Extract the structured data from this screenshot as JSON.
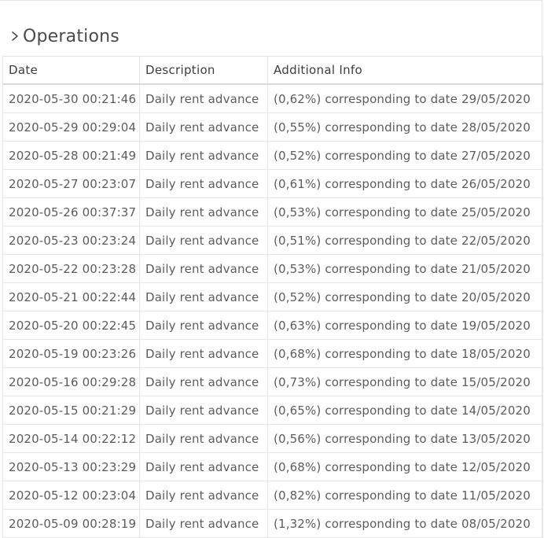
{
  "section": {
    "title": "Operations"
  },
  "table": {
    "headers": {
      "date": "Date",
      "description": "Description",
      "info": "Additional Info"
    },
    "rows": [
      {
        "date": "2020-05-30 00:21:46",
        "description": "Daily rent advance",
        "info": "(0,62%) corresponding to date 29/05/2020"
      },
      {
        "date": "2020-05-29 00:29:04",
        "description": "Daily rent advance",
        "info": "(0,55%) corresponding to date 28/05/2020"
      },
      {
        "date": "2020-05-28 00:21:49",
        "description": "Daily rent advance",
        "info": "(0,52%) corresponding to date 27/05/2020"
      },
      {
        "date": "2020-05-27 00:23:07",
        "description": "Daily rent advance",
        "info": "(0,61%) corresponding to date 26/05/2020"
      },
      {
        "date": "2020-05-26 00:37:37",
        "description": "Daily rent advance",
        "info": "(0,53%) corresponding to date 25/05/2020"
      },
      {
        "date": "2020-05-23 00:23:24",
        "description": "Daily rent advance",
        "info": "(0,51%) corresponding to date 22/05/2020"
      },
      {
        "date": "2020-05-22 00:23:28",
        "description": "Daily rent advance",
        "info": "(0,53%) corresponding to date 21/05/2020"
      },
      {
        "date": "2020-05-21 00:22:44",
        "description": "Daily rent advance",
        "info": "(0,52%) corresponding to date 20/05/2020"
      },
      {
        "date": "2020-05-20 00:22:45",
        "description": "Daily rent advance",
        "info": "(0,63%) corresponding to date 19/05/2020"
      },
      {
        "date": "2020-05-19 00:23:26",
        "description": "Daily rent advance",
        "info": "(0,68%) corresponding to date 18/05/2020"
      },
      {
        "date": "2020-05-16 00:29:28",
        "description": "Daily rent advance",
        "info": "(0,73%) corresponding to date 15/05/2020"
      },
      {
        "date": "2020-05-15 00:21:29",
        "description": "Daily rent advance",
        "info": "(0,65%) corresponding to date 14/05/2020"
      },
      {
        "date": "2020-05-14 00:22:12",
        "description": "Daily rent advance",
        "info": "(0,56%) corresponding to date 13/05/2020"
      },
      {
        "date": "2020-05-13 00:23:29",
        "description": "Daily rent advance",
        "info": "(0,68%) corresponding to date 12/05/2020"
      },
      {
        "date": "2020-05-12 00:23:04",
        "description": "Daily rent advance",
        "info": "(0,82%) corresponding to date 11/05/2020"
      },
      {
        "date": "2020-05-09 00:28:19",
        "description": "Daily rent advance",
        "info": "(1,32%) corresponding to date 08/05/2020"
      }
    ]
  },
  "icons": {
    "chevron": "chevron-right-icon"
  }
}
